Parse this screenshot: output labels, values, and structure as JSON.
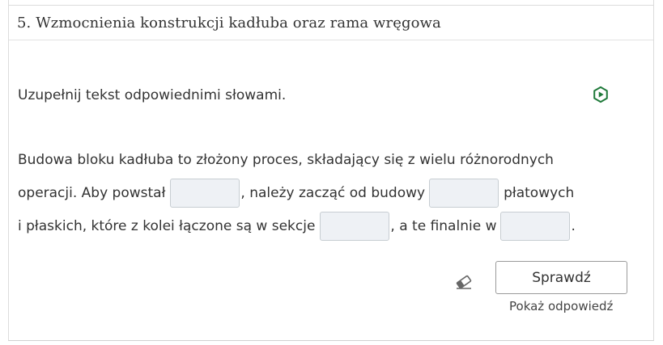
{
  "exercise": {
    "title": "5. Wzmocnienia konstrukcji kadłuba oraz rama wręgowa",
    "instruction": "Uzupełnij tekst odpowiednimi słowami.",
    "icon": "hexagon-play-icon",
    "accent_color": "#1f7a3a"
  },
  "paragraph": {
    "line1": "Budowa bloku kadłuba to złożony proces, składający się z wielu różnorodnych",
    "line2_a": "operacji. Aby powstał",
    "line2_b": ", należy zacząć od budowy",
    "line2_c": "płatowych",
    "line3_a": "i płaskich, które z kolei łączone są w sekcje",
    "line3_b": ", a te finalnie w",
    "line3_c": ".",
    "gaps": [
      {
        "value": ""
      },
      {
        "value": ""
      },
      {
        "value": ""
      },
      {
        "value": ""
      }
    ]
  },
  "actions": {
    "check_label": "Sprawdź",
    "show_answer_label": "Pokaż odpowiedź",
    "clear_icon": "eraser-icon"
  }
}
